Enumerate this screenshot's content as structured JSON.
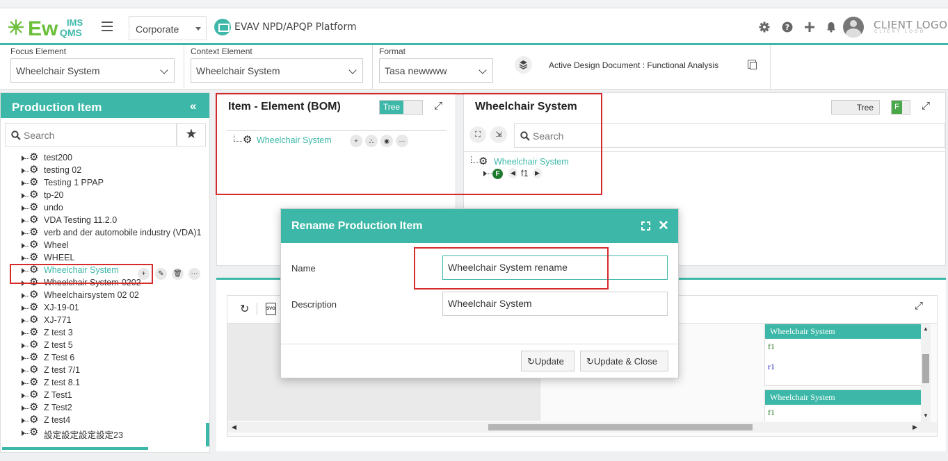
{
  "header": {
    "logo_main": "Ew",
    "logo_top": "IMS",
    "logo_bottom": "QMS",
    "company_select": "Corporate",
    "platform_title": "EVAV NPD/APQP Platform",
    "client_logo": "CLIENT LOGO",
    "client_logo_sub": "CLIENT LOGO"
  },
  "selectors": {
    "focus_label": "Focus Element",
    "focus_value": "Wheelchair System",
    "context_label": "Context Element",
    "context_value": "Wheelchair System",
    "format_label": "Format",
    "format_value": "Tasa newwww",
    "active_doc": "Active Design Document : Functional Analysis"
  },
  "left_panel": {
    "title": "Production Item",
    "collapse": "«",
    "search_placeholder": "Search",
    "items": [
      "test200",
      "testing 02",
      "Testing 1 PPAP",
      "tp-20",
      "undo",
      "VDA Testing 11.2.0",
      "verb and der automobile industry (VDA)1",
      "Wheel",
      "WHEEL",
      "Wheelchair System",
      "Wheelchair System-0202",
      "Wheelchairsystem 02 02",
      "XJ-19-01",
      "XJ-771",
      "Z test 3",
      "Z test 5",
      "Z Test 6",
      "Z test 7/1",
      "Z test 8.1",
      "Z Test1",
      "Z Test2",
      "Z test4",
      "設定設定設定設定23"
    ],
    "selected_item": "Wheelchair System"
  },
  "bom_panel": {
    "title": "Item - Element (BOM)",
    "toggle_label": "Tree",
    "node_label": "Wheelchair System"
  },
  "ws_panel": {
    "title": "Wheelchair System",
    "toggle_label": "Tree",
    "f_badge": "F",
    "search_placeholder": "Search",
    "root_node": "Wheelchair System",
    "child_badge": "F",
    "child_label": "f1"
  },
  "bottom_panel": {
    "cards": [
      {
        "title": "Wheelchair System",
        "items": [
          "f1",
          "r1"
        ]
      },
      {
        "title": "Wheelchair System",
        "items": [
          "f1"
        ]
      }
    ]
  },
  "dialog": {
    "title": "Rename Production Item",
    "name_label": "Name",
    "name_value": "Wheelchair System rename",
    "description_label": "Description",
    "description_value": "Wheelchair System",
    "update_label": "Update",
    "update_close_label": "Update & Close"
  },
  "colors": {
    "accent": "#3db8a8",
    "highlight": "#d62b2b",
    "badge_green": "#4aa84a"
  }
}
